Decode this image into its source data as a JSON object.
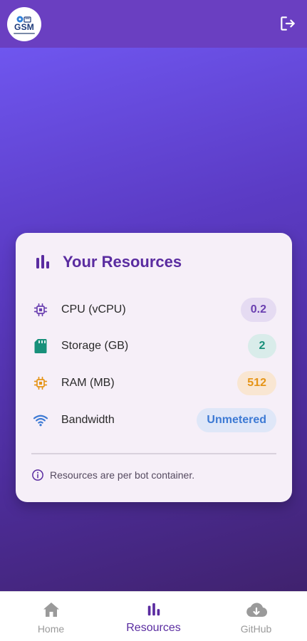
{
  "app_bar": {
    "logo_text": "GSM",
    "logo_icon": "gsm-logo-icon",
    "logout_icon": "logout-icon"
  },
  "card": {
    "title": "Your Resources",
    "title_icon": "bar-chart-icon",
    "resources": [
      {
        "label": "CPU (vCPU)",
        "value": "0.2",
        "icon": "cpu-chip-icon",
        "color": "#6a3fb0"
      },
      {
        "label": "Storage (GB)",
        "value": "2",
        "icon": "sd-card-icon",
        "color": "#18907a"
      },
      {
        "label": "RAM (MB)",
        "value": "512",
        "icon": "memory-chip-icon",
        "color": "#e59416"
      },
      {
        "label": "Bandwidth",
        "value": "Unmetered",
        "icon": "wifi-icon",
        "color": "#3d7ad4"
      }
    ],
    "note": "Resources are per bot container.",
    "note_icon": "info-icon"
  },
  "bottom_nav": {
    "items": [
      {
        "label": "Home",
        "icon": "home-icon",
        "active": false
      },
      {
        "label": "Resources",
        "icon": "bar-chart-icon",
        "active": true
      },
      {
        "label": "GitHub",
        "icon": "cloud-download-icon",
        "active": false
      }
    ]
  },
  "colors": {
    "app_bar": "#6a3fc1",
    "accent": "#5a2ca0",
    "card_bg": "#f6eff8"
  }
}
